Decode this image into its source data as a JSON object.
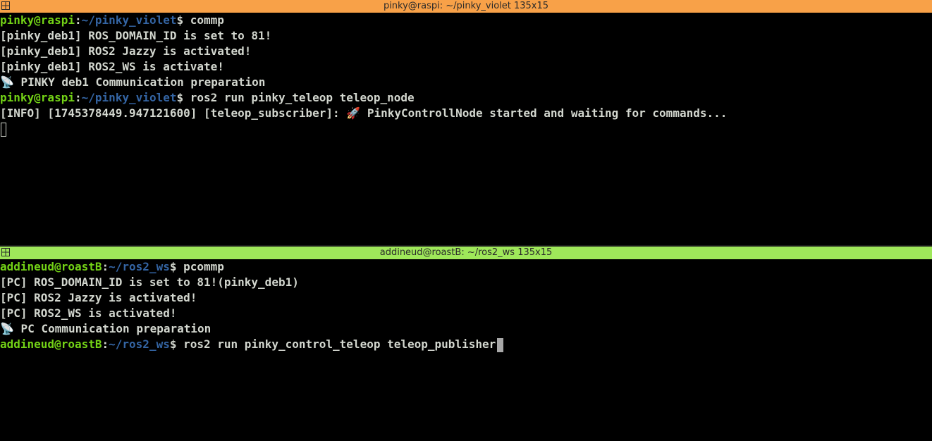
{
  "top_pane": {
    "title": "pinky@raspi: ~/pinky_violet 135x15",
    "title_color": "#f8a148",
    "prompt_user": "pinky@raspi",
    "prompt_sep": ":",
    "prompt_path": "~/pinky_violet",
    "prompt_end": "$ ",
    "command_1": "commp",
    "output": [
      "[pinky_deb1] ROS_DOMAIN_ID is set to 81!",
      "[pinky_deb1] ROS2 Jazzy is activated!",
      "[pinky_deb1] ROS2_WS is activate!"
    ],
    "prep_emoji": "📡",
    "prep_text": " PINKY deb1 Communication preparation",
    "command_2": "ros2 run pinky_teleop teleop_node",
    "info_prefix": "[INFO] [1745378449.947121600] [teleop_subscriber]: ",
    "info_emoji": "🚀",
    "info_text": " PinkyControllNode started and waiting for commands..."
  },
  "bottom_pane": {
    "title": "addineud@roastB: ~/ros2_ws 135x15",
    "title_color": "#9fe85a",
    "prompt_user": "addineud@roastB",
    "prompt_sep": ":",
    "prompt_path": "~/ros2_ws",
    "prompt_end": "$ ",
    "command_1": "pcommp",
    "output": [
      "[PC] ROS_DOMAIN_ID is set to 81!(pinky_deb1)",
      "[PC] ROS2 Jazzy is activated!",
      "[PC] ROS2_WS is activated!"
    ],
    "prep_emoji": "📡",
    "prep_text": " PC Communication preparation",
    "command_2": "ros2 run pinky_control_teleop teleop_publisher"
  },
  "colors": {
    "background": "#000000",
    "prompt_user": "#73d216",
    "prompt_path": "#3465a4",
    "text": "#d3d7cf"
  },
  "icons": {
    "window_menu": "window-menu-icon",
    "antenna": "satellite-antenna-icon",
    "rocket": "rocket-icon"
  }
}
